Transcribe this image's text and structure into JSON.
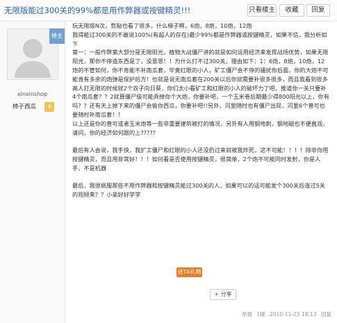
{
  "thread": {
    "title": "无限版能过300关的99%都是用作弊器或按键精灵!!!",
    "buttons": {
      "only_op": "只看楼主",
      "favorite": "收藏",
      "reply": "回复"
    }
  },
  "post": {
    "author": "xinxinshop",
    "level_name": "柿子西瓜",
    "level_num": "4",
    "corner_badge": "楼主",
    "paragraphs": [
      "玩无限版N次，剪贴也看了很多，什么梯子啊，6炮，8炮，10炮，12炮",
      "我得能过300关的不敢说100%(有超人的存在)最少99%都是作弊器或按键精灵，如果不信，我分析如下",
      "第一：一般作弊第大部分是无限阳光，植物大战僵尸讲的就是如何运用经济来发挥战场优势，如果无限阳光，那你不停造东西是了，没意思！！为什么打不过300关，理由如下：1：6炮，8炮，10炮，12炮的不管如何，你不肯能不补南瓜套，毕竟红眼的小人，矿工僵尸会不停的骚扰你后面，你的大炮不可能肯有多余的炮弹是保护后方！也就是说无南瓜套在200关以后你就需要补很多很多，而且我看到很多高人打无限的时候就2个双子向日葵，你们太小看矿工和红眼的小人的破坏力了吧，推道你一关只要补4个南瓜套？？2就算僵尸级可能弄掉你个大炮，你要补吧，一个玉米卷后期最少得800阳光以上，你有吗？？还有天上掉下来的僵尸会偷你西瓜，你要补吧!!另外，河里随时也有僵尸出现，河里6个普可也要随时补南瓜套！！",
      "以上还是你的普可或者玉米炮等一些非重要建筑被打的情况，另外有人用钢地刺，钢地磁也不便直观，请问，你的经济如何跟的上?????",
      "",
      "最后有人会说，我手快，我扩工僵尸和红眼的小人还没扔过来就被我炸死，这不可能！！！！除非你用按键精灵，而且用非常好！！！如何看是否使用按键精灵，很简单，2个炮不可能同时发射，你是人手，不是机器",
      "",
      "最后，我很佩服那些不用作弊器和按键精灵能过300关的人，如果可以的话可能发个300关后连过5关的视频来？？小弟好好学学"
    ]
  },
  "actions": {
    "like": "送TA礼物",
    "share": "分享"
  },
  "footer": {
    "report": "举报",
    "floor": "1楼",
    "datetime": "2010-11-25 18:13",
    "reply": "回复"
  }
}
